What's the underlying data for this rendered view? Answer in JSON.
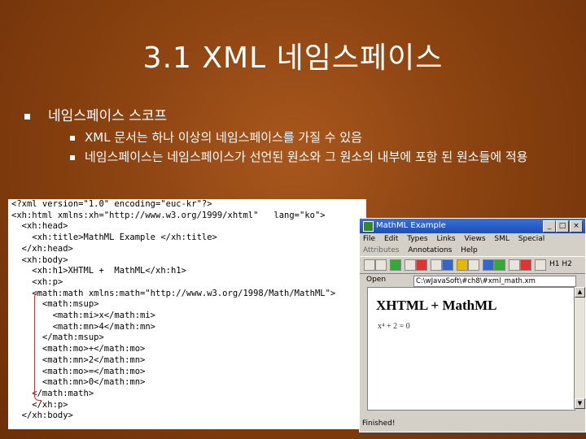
{
  "slide": {
    "title": "3.1 XML 네임스페이스",
    "bullet1": "네임스페이스 스코프",
    "sub_bullets": [
      "XML 문서는 하나 이상의 네임스페이스를 가질 수 있음",
      "네임스페이스는 네임스페이스가 선언된 원소와 그 원소의 내부에 포함 된 원소들에 적용"
    ]
  },
  "code_lines": [
    "<?xml version=\"1.0\" encoding=\"euc-kr\"?>",
    "<xh:html xmlns:xh=\"http://www.w3.org/1999/xhtml\"   lang=\"ko\">",
    "  <xh:head>",
    "    <xh:title>MathML Example </xh:title>",
    "  </xh:head>",
    "  <xh:body>",
    "    <xh:h1>XHTML +  MathML</xh:h1>",
    "    <xh:p>",
    "    <math:math xmlns:math=\"http://www.w3.org/1998/Math/MathML\">",
    "      <math:msup>",
    "        <math:mi>x</math:mi>",
    "        <math:mn>4</math:mn>",
    "      </math:msup>",
    "      <math:mo>+</math:mo>",
    "      <math:mn>2</math:mn>",
    "      <math:mo>=</math:mo>",
    "      <math:mn>0</math:mn>",
    "    </math:math>",
    "    </xh:p>",
    "  </xh:body>"
  ],
  "window": {
    "title": "MathML Example",
    "menu1": [
      "File",
      "Edit",
      "Types",
      "Links",
      "Views",
      "SML",
      "Special"
    ],
    "menu2": [
      "Attributes",
      "Annotations",
      "Help"
    ],
    "toolbar_label": "H1 H2",
    "open_label": "Open",
    "url": "C:\\wJavaSoft\\#ch8\\#xml_math.xm",
    "heading": "XHTML + MathML",
    "math": "x⁴ + 2 = 0",
    "status": "Finished!"
  }
}
